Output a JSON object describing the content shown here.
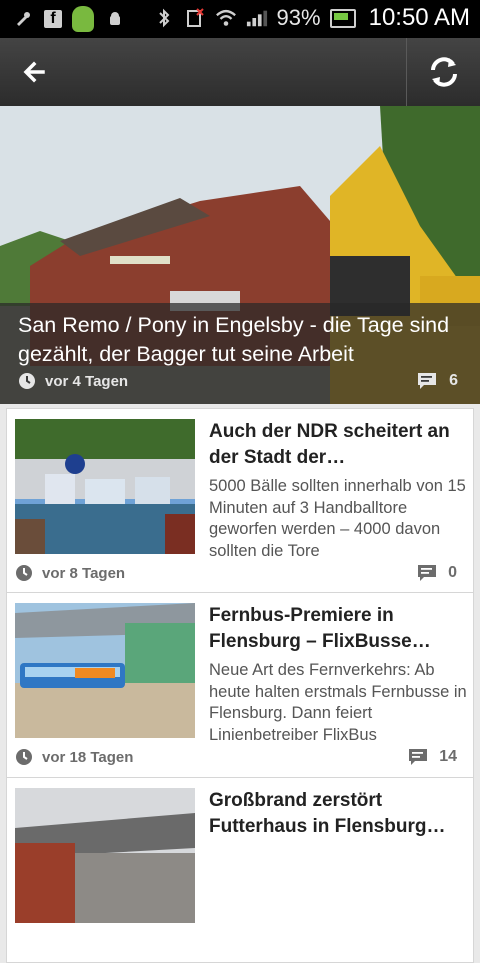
{
  "status_bar": {
    "battery_percent": "93%",
    "time": "10:50 AM",
    "icons": [
      "tools-icon",
      "facebook-icon",
      "android-app-icon",
      "usb-debug-icon",
      "bluetooth-icon",
      "sim-alert-icon",
      "wifi-icon",
      "signal-icon",
      "battery-icon"
    ]
  },
  "action_bar": {
    "back_icon": "arrow-left-icon",
    "refresh_icon": "refresh-icon"
  },
  "hero": {
    "title": "San Remo / Pony in Engelsby - die Tage sind gezählt, der Bagger tut seine Arbeit",
    "age": "vor 4 Tagen",
    "comments": "6"
  },
  "articles": [
    {
      "title": "Auch der NDR scheitert an der Stadt der…",
      "description": "5000 Bälle sollten innerhalb von 15 Minuten auf 3 Handballtore geworfen werden – 4000 davon sollten die Tore",
      "age": "vor 8 Tagen",
      "comments": "0"
    },
    {
      "title": "Fernbus-Premiere in Flensburg – FlixBusse…",
      "description": "Neue Art des Fernverkehrs: Ab heute halten erstmals Fernbusse in Flensburg. Dann feiert Linienbetreiber FlixBus",
      "age": "vor 18 Tagen",
      "comments": "14"
    },
    {
      "title": "Großbrand zerstört Futterhaus in Flensburg…",
      "description": "",
      "age": "",
      "comments": ""
    }
  ]
}
